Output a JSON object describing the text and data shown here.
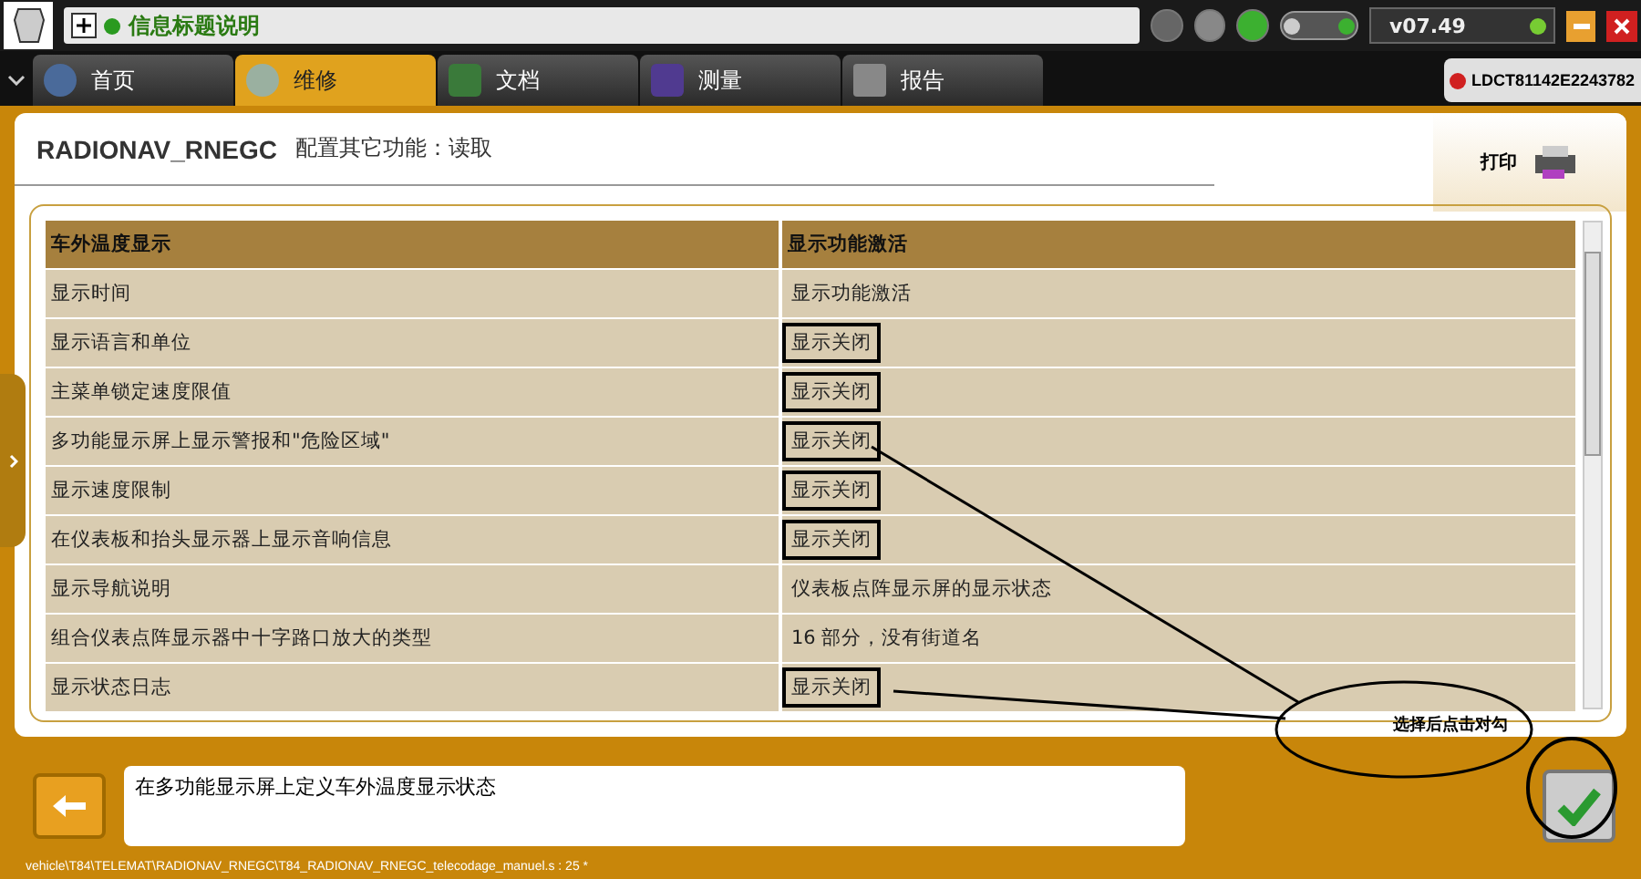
{
  "topbar": {
    "title": "信息标题说明",
    "version": "v07.49"
  },
  "tabs": [
    {
      "label": "首页",
      "selected": false
    },
    {
      "label": "维修",
      "selected": true
    },
    {
      "label": "文档",
      "selected": false
    },
    {
      "label": "测量",
      "selected": false
    },
    {
      "label": "报告",
      "selected": false
    }
  ],
  "vehicle_id": "LDCT81142E2243782",
  "panel": {
    "title": "RADIONAV_RNEGC",
    "subtitle": "配置其它功能：读取",
    "print_label": "打印"
  },
  "table": {
    "columns": [
      "车外温度显示",
      "显示功能激活"
    ],
    "rows": [
      {
        "name": "显示时间",
        "value": "显示功能激活",
        "marked": false
      },
      {
        "name": "显示语言和单位",
        "value": "显示关闭",
        "marked": true
      },
      {
        "name": "主菜单锁定速度限值",
        "value": "显示关闭",
        "marked": true
      },
      {
        "name": "多功能显示屏上显示警报和\"危险区域\"",
        "value": "显示关闭",
        "marked": true
      },
      {
        "name": "显示速度限制",
        "value": "显示关闭",
        "marked": true
      },
      {
        "name": "在仪表板和抬头显示器上显示音响信息",
        "value": "显示关闭",
        "marked": true
      },
      {
        "name": "显示导航说明",
        "value": "仪表板点阵显示屏的显示状态",
        "marked": false
      },
      {
        "name": "组合仪表点阵显示器中十字路口放大的类型",
        "value": "16 部分，没有街道名",
        "marked": false
      },
      {
        "name": "显示状态日志",
        "value": "显示关闭",
        "marked": true
      }
    ]
  },
  "annotation": {
    "note": "选择后点击对勾"
  },
  "description": "在多功能显示屏上定义车外温度显示状态",
  "status_path": "vehicle\\T84\\TELEMAT\\RADIONAV_RNEGC\\T84_RADIONAV_RNEGC_telecodage_manuel.s : 25 *"
}
